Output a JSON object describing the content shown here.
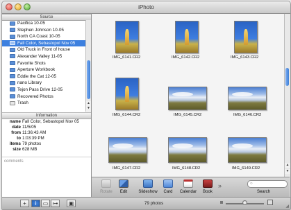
{
  "window": {
    "title": "iPhoto"
  },
  "source": {
    "header": "Source",
    "items": [
      {
        "label": "Pacifica 10-05",
        "selected": false,
        "icon": "album-icon"
      },
      {
        "label": "Stephen Johnson 10-05",
        "selected": false,
        "icon": "album-icon"
      },
      {
        "label": "North CA Coast 10-05",
        "selected": false,
        "icon": "album-icon"
      },
      {
        "label": "Fall Color, Sebastopol Nov 05",
        "selected": true,
        "icon": "album-icon"
      },
      {
        "label": "Old Truck in Front of house",
        "selected": false,
        "icon": "album-icon"
      },
      {
        "label": "Alexander Valley 11-05",
        "selected": false,
        "icon": "album-icon"
      },
      {
        "label": "Favorite Shots",
        "selected": false,
        "icon": "album-icon"
      },
      {
        "label": "Aperture Workbook",
        "selected": false,
        "icon": "album-icon"
      },
      {
        "label": "Eddie the Cat 12-05",
        "selected": false,
        "icon": "album-icon"
      },
      {
        "label": "nano Library",
        "selected": false,
        "icon": "album-icon"
      },
      {
        "label": "Tejon Pass Drive 12-05",
        "selected": false,
        "icon": "album-icon"
      },
      {
        "label": "Recovered Photos",
        "selected": false,
        "icon": "album-icon"
      },
      {
        "label": "Trash",
        "selected": false,
        "icon": "trash-icon"
      }
    ]
  },
  "information": {
    "header": "Information",
    "name_key": "name",
    "name": "Fall Color, Sebastopol Nov 05",
    "date_key": "date",
    "date": "11/5/05",
    "from_key": "from",
    "from": "11:36:43 AM",
    "to_key": "to",
    "to": "1:03:39 PM",
    "items_key": "items",
    "items": "79 photos",
    "size_key": "size",
    "size": "628 MB",
    "comments_placeholder": "comments"
  },
  "photos": [
    {
      "caption": "IMG_6141.CR2",
      "orientation": "portrait"
    },
    {
      "caption": "IMG_6142.CR2",
      "orientation": "portrait"
    },
    {
      "caption": "IMG_6143.CR2",
      "orientation": "portrait"
    },
    {
      "caption": "IMG_6144.CR2",
      "orientation": "portrait"
    },
    {
      "caption": "IMG_6145.CR2",
      "orientation": "landscape"
    },
    {
      "caption": "IMG_6146.CR2",
      "orientation": "landscape"
    },
    {
      "caption": "IMG_6147.CR2",
      "orientation": "landscape"
    },
    {
      "caption": "IMG_6148.CR2",
      "orientation": "landscape"
    },
    {
      "caption": "IMG_6149.CR2",
      "orientation": "landscape"
    }
  ],
  "toolbar": {
    "rotate": "Rotate",
    "edit": "Edit",
    "slideshow": "Slideshow",
    "card": "Card",
    "calendar": "Calendar",
    "book": "Book",
    "more": "»",
    "search": "Search"
  },
  "status": {
    "photo_count": "79 photos",
    "add_button": "+",
    "info_button": "i",
    "calendar_button": "▭",
    "keyword_button": "⊶",
    "fullscreen_button": "▣"
  },
  "colors": {
    "selection": "#3d80df",
    "folder": "#5b8fd6"
  }
}
